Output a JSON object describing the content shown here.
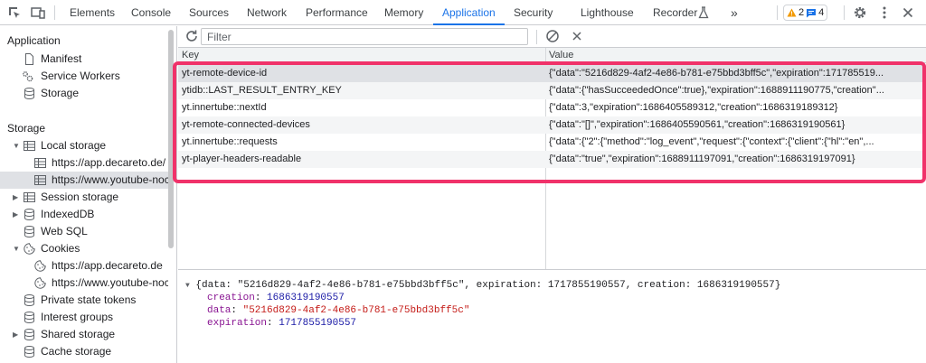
{
  "tabs": [
    "Elements",
    "Console",
    "Sources",
    "Network",
    "Performance",
    "Memory",
    "Application",
    "Security",
    "Lighthouse",
    "Recorder"
  ],
  "active_tab": "Application",
  "more_tabs": "»",
  "warnings_count": "2",
  "messages_count": "4",
  "sidebar": {
    "application_header": "Application",
    "application_items": [
      "Manifest",
      "Service Workers",
      "Storage"
    ],
    "storage_header": "Storage",
    "local_storage": "Local storage",
    "local_storage_children": [
      "https://app.decareto.de/",
      "https://www.youtube-noc"
    ],
    "session_storage": "Session storage",
    "indexeddb": "IndexedDB",
    "websql": "Web SQL",
    "cookies": "Cookies",
    "cookies_children": [
      "https://app.decareto.de",
      "https://www.youtube-noc"
    ],
    "private_state_tokens": "Private state tokens",
    "interest_groups": "Interest groups",
    "shared_storage": "Shared storage",
    "cache_storage": "Cache storage"
  },
  "filter": {
    "placeholder": "Filter"
  },
  "table": {
    "key_header": "Key",
    "value_header": "Value",
    "rows": [
      {
        "key": "yt-remote-device-id",
        "value": "{\"data\":\"5216d829-4af2-4e86-b781-e75bbd3bff5c\",\"expiration\":171785519..."
      },
      {
        "key": "ytidb::LAST_RESULT_ENTRY_KEY",
        "value": "{\"data\":{\"hasSucceededOnce\":true},\"expiration\":1688911190775,\"creation\"..."
      },
      {
        "key": "yt.innertube::nextId",
        "value": "{\"data\":3,\"expiration\":1686405589312,\"creation\":1686319189312}"
      },
      {
        "key": "yt-remote-connected-devices",
        "value": "{\"data\":\"[]\",\"expiration\":1686405590561,\"creation\":1686319190561}"
      },
      {
        "key": "yt.innertube::requests",
        "value": "{\"data\":{\"2\":{\"method\":\"log_event\",\"request\":{\"context\":{\"client\":{\"hl\":\"en\",..."
      },
      {
        "key": "yt-player-headers-readable",
        "value": "{\"data\":\"true\",\"expiration\":1688911197091,\"creation\":1686319197091}"
      }
    ]
  },
  "preview": {
    "summary": "{data: \"5216d829-4af2-4e86-b781-e75bbd3bff5c\", expiration: 1717855190557, creation: 1686319190557}",
    "props": [
      {
        "key": "creation",
        "value": "1686319190557",
        "kind": "num"
      },
      {
        "key": "data",
        "value": "\"5216d829-4af2-4e86-b781-e75bbd3bff5c\"",
        "kind": "str"
      },
      {
        "key": "expiration",
        "value": "1717855190557",
        "kind": "num"
      }
    ]
  },
  "colors": {
    "accent": "#1a73e8",
    "highlight": "#f0326a",
    "warning": "#f29900"
  }
}
